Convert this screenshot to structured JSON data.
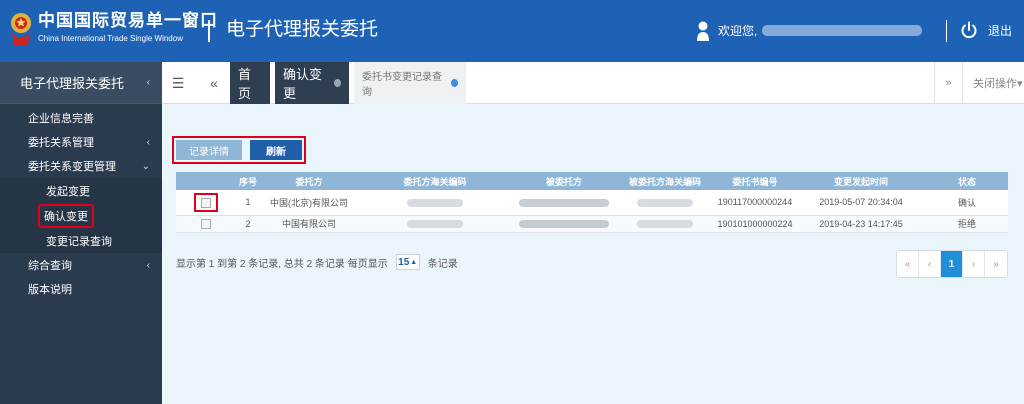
{
  "header": {
    "brand_cn": "中国国际贸易单一窗口",
    "brand_en": "China International Trade Single Window",
    "app_title": "电子代理报关委托",
    "welcome": "欢迎您,",
    "logout": "退出"
  },
  "sidebar": {
    "title": "电子代理报关委托",
    "items": [
      {
        "label": "企业信息完善"
      },
      {
        "label": "委托关系管理"
      },
      {
        "label": "委托关系变更管理"
      }
    ],
    "sub_items": [
      {
        "label": "发起变更"
      },
      {
        "label": "确认变更"
      },
      {
        "label": "变更记录查询"
      }
    ],
    "items_after": [
      {
        "label": "综合查询"
      },
      {
        "label": "版本说明"
      }
    ]
  },
  "tabs": {
    "home": "首页",
    "confirm": "确认变更",
    "record": "委托书变更记录查询",
    "close_ops": "关闭操作"
  },
  "toolbar": {
    "detail_label": "记录详情",
    "refresh_label": "刷新"
  },
  "table": {
    "headers": [
      "",
      "序号",
      "委托方",
      "委托方海关编码",
      "被委托方",
      "被委托方海关编码",
      "委托书编号",
      "变更发起时间",
      "状态"
    ],
    "rows": [
      {
        "index": "1",
        "client": "中国(北京)有限公司",
        "contract_no": "190117000000244",
        "time": "2019-05-07 20:34:04",
        "status": "确认"
      },
      {
        "index": "2",
        "client": "中国有限公司",
        "contract_no": "190101000000224",
        "time": "2019-04-23 14:17:45",
        "status": "拒绝"
      }
    ]
  },
  "pager": {
    "info_prefix": "显示第 1 到第 2 条记录, 总共 2 条记录 每页显示",
    "page_size": "15",
    "info_suffix": "条记录",
    "buttons": [
      "«",
      "‹",
      "1",
      "›",
      "»"
    ]
  },
  "colors": {
    "header": "#1e62b6",
    "sidebar": "#2b3b4e",
    "accent": "#1e8fd8",
    "highlight": "#e0001b"
  }
}
